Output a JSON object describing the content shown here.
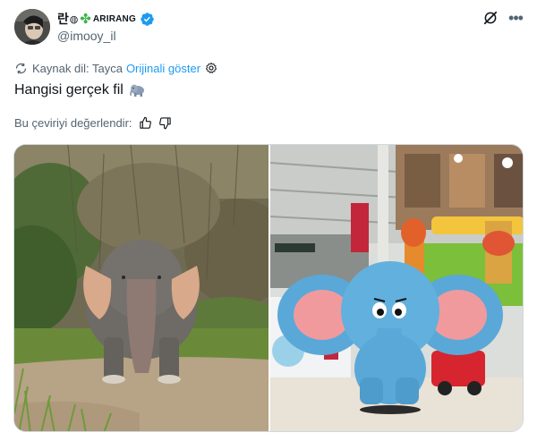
{
  "author": {
    "name_prefix": "란",
    "name_suffix": "ARIRANG",
    "handle": "@imooy_il"
  },
  "icons": {
    "verified": "verified-badge-icon",
    "grok": "grok-icon",
    "more": "more-icon",
    "translate": "translate-icon",
    "settings": "gear-icon",
    "like": "thumbs-up-icon",
    "dislike": "thumbs-down-icon",
    "emoji": "elephant-emoji"
  },
  "translation": {
    "source_lang": "Kaynak dil: Tayca",
    "show_original": "Orijinali göster"
  },
  "tweet": {
    "text": "Hangisi gerçek fil"
  },
  "rating": {
    "label": "Bu çeviriyi değerlendir:"
  },
  "colors": {
    "accent": "#1d9bf0",
    "secondary_text": "#536471",
    "border": "#cfd9de"
  }
}
